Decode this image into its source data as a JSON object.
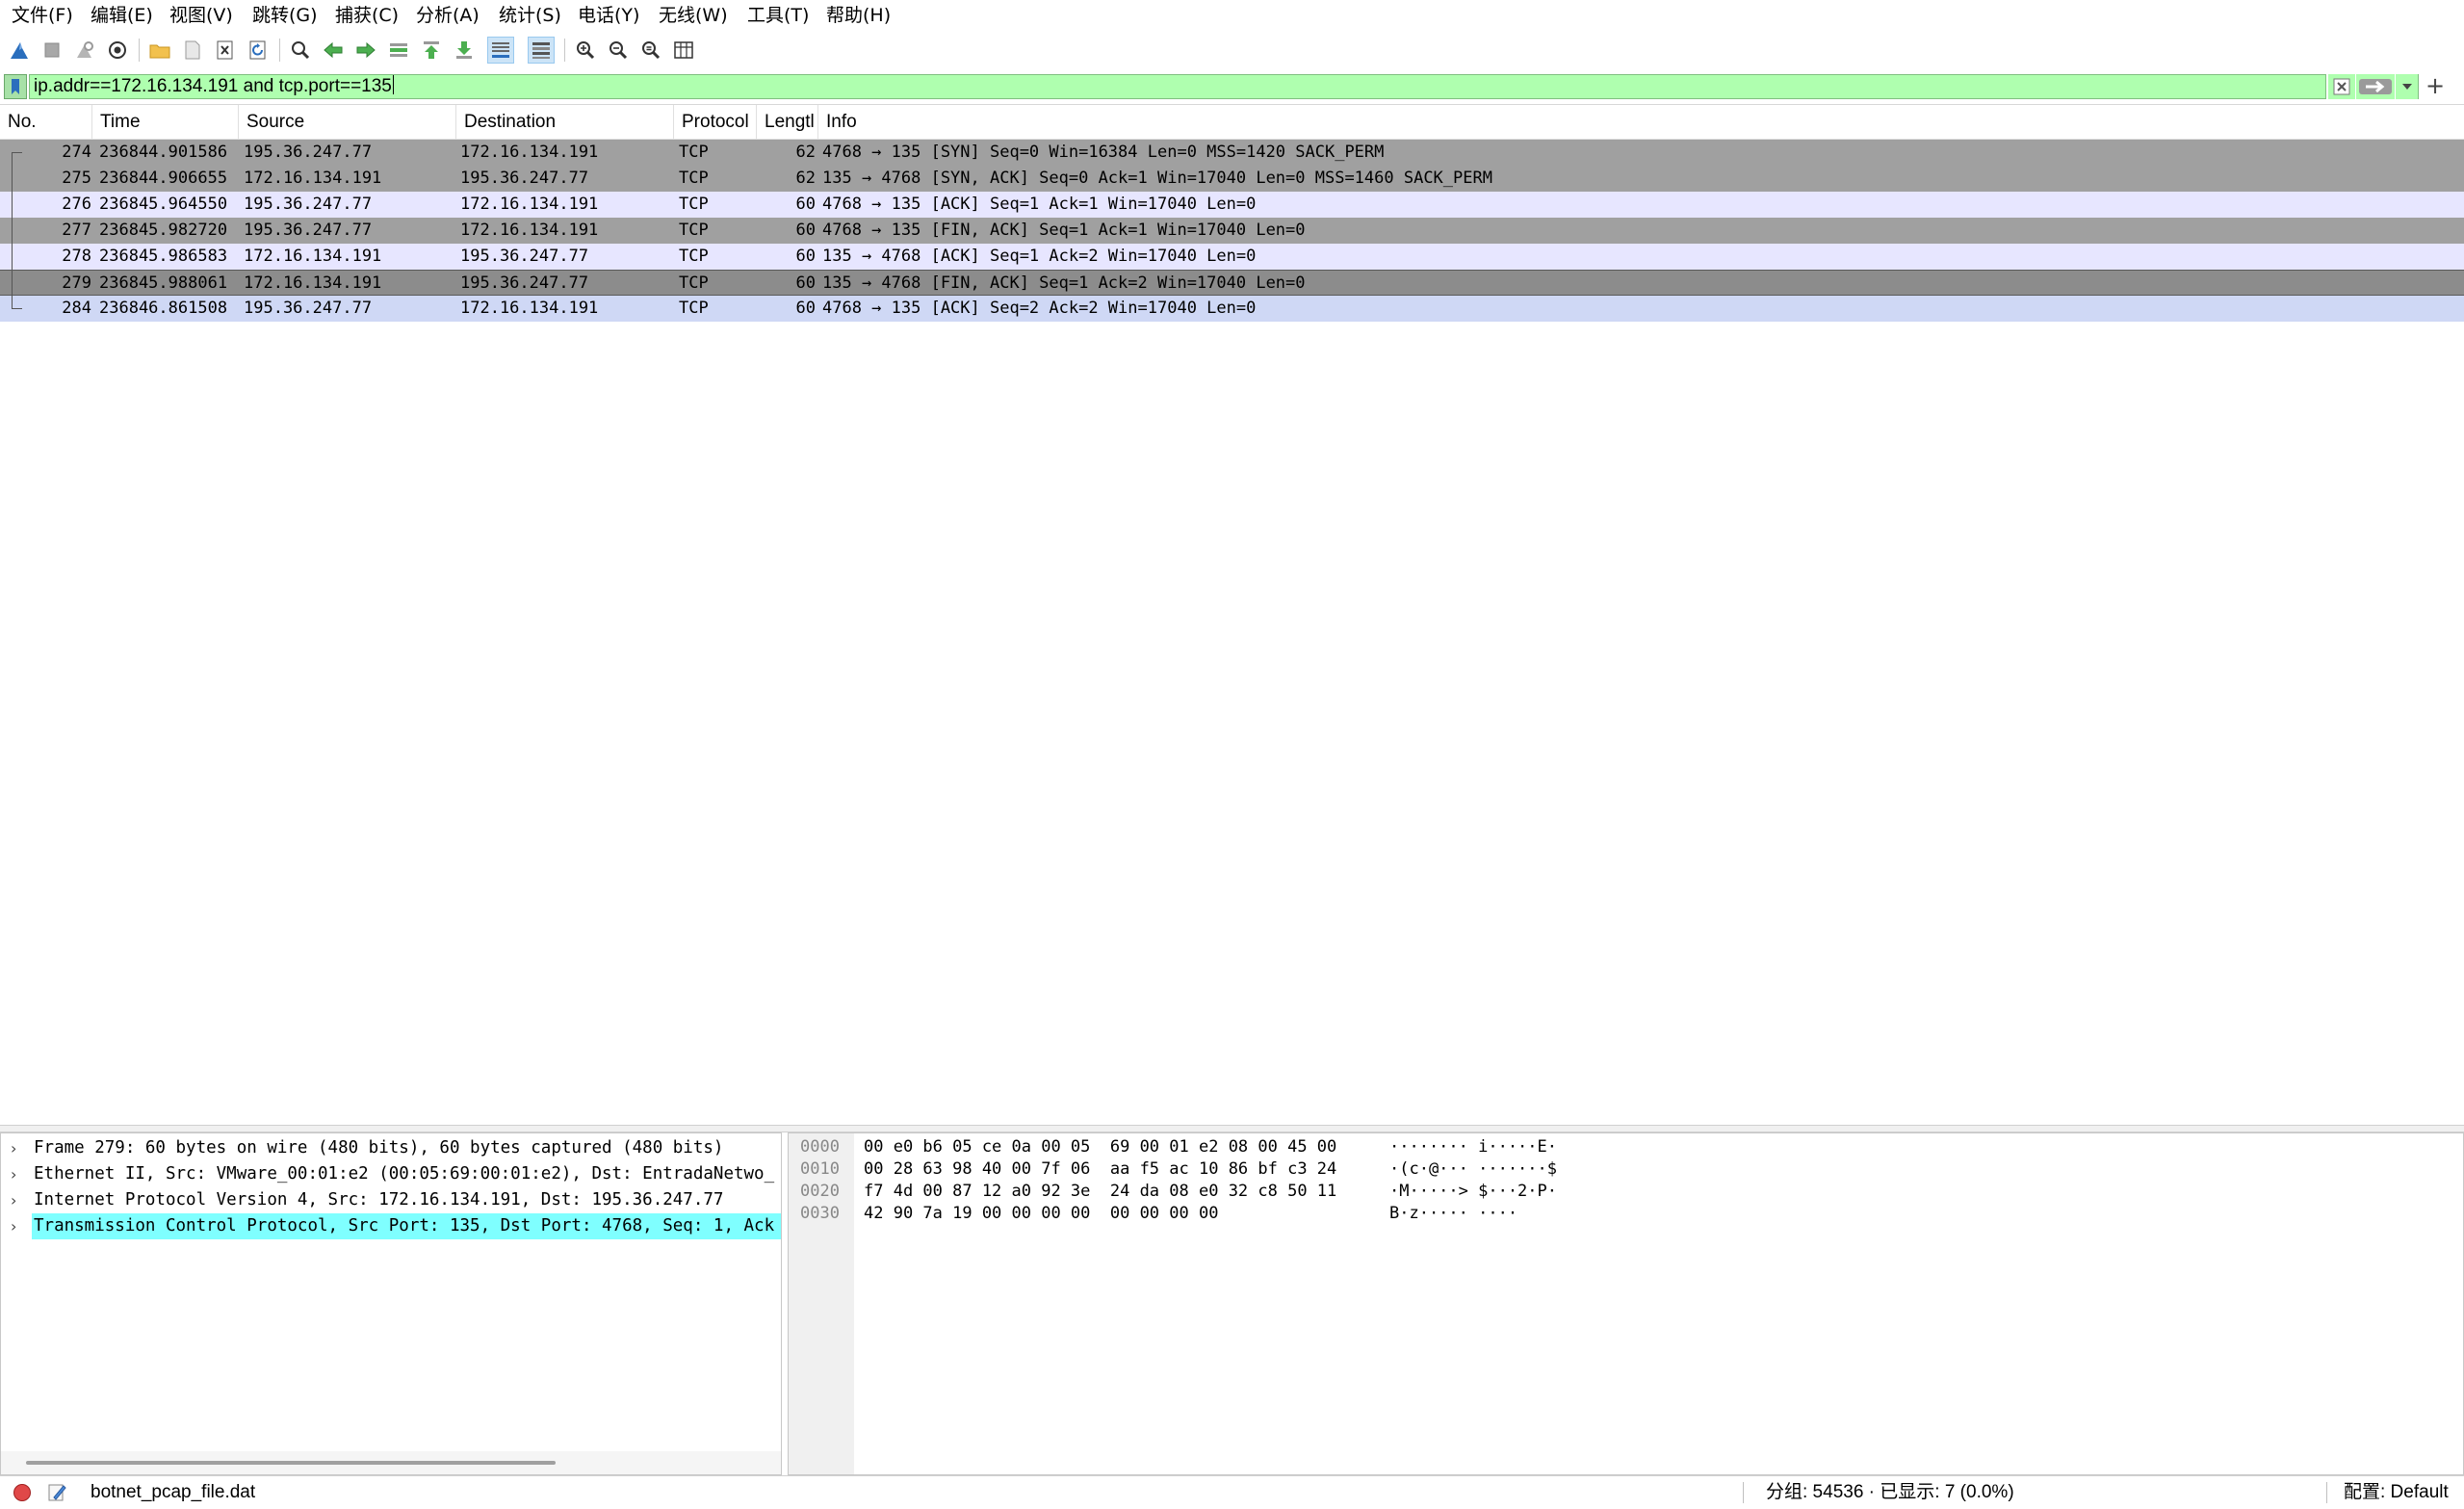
{
  "menu": [
    "文件(F)",
    "编辑(E)",
    "视图(V)",
    "跳转(G)",
    "捕获(C)",
    "分析(A)",
    "统计(S)",
    "电话(Y)",
    "无线(W)",
    "工具(T)",
    "帮助(H)"
  ],
  "toolbar": {
    "icons": [
      "shark-fin-start-icon",
      "stop-square-icon",
      "restart-fin-icon",
      "capture-options-gear-icon",
      "open-folder-icon",
      "save-file-icon",
      "close-file-icon",
      "reload-icon",
      "find-magnifier-icon",
      "go-back-arrow-icon",
      "go-forward-arrow-icon",
      "go-to-packet-icon",
      "go-first-packet-icon",
      "go-last-packet-icon",
      "autoscroll-icon",
      "colorize-lines-icon",
      "zoom-in-icon",
      "zoom-out-icon",
      "zoom-normal-icon",
      "resize-columns-icon"
    ]
  },
  "filter": {
    "value": "ip.addr==172.16.134.191 and tcp.port==135",
    "bg_color": "#afffaf"
  },
  "packet_list": {
    "columns": [
      "No.",
      "Time",
      "Source",
      "Destination",
      "Protocol",
      "Lengtl",
      "Info"
    ],
    "rows": [
      {
        "no": "274",
        "time": "236844.901586",
        "src": "195.36.247.77",
        "dst": "172.16.134.191",
        "proto": "TCP",
        "len": "62",
        "info": "4768 → 135 [SYN] Seq=0 Win=16384 Len=0 MSS=1420 SACK_PERM",
        "style": "dark"
      },
      {
        "no": "275",
        "time": "236844.906655",
        "src": "172.16.134.191",
        "dst": "195.36.247.77",
        "proto": "TCP",
        "len": "62",
        "info": "135 → 4768 [SYN, ACK] Seq=0 Ack=1 Win=17040 Len=0 MSS=1460 SACK_PERM",
        "style": "dark"
      },
      {
        "no": "276",
        "time": "236845.964550",
        "src": "195.36.247.77",
        "dst": "172.16.134.191",
        "proto": "TCP",
        "len": "60",
        "info": "4768 → 135 [ACK] Seq=1 Ack=1 Win=17040 Len=0",
        "style": "light"
      },
      {
        "no": "277",
        "time": "236845.982720",
        "src": "195.36.247.77",
        "dst": "172.16.134.191",
        "proto": "TCP",
        "len": "60",
        "info": "4768 → 135 [FIN, ACK] Seq=1 Ack=1 Win=17040 Len=0",
        "style": "dark"
      },
      {
        "no": "278",
        "time": "236845.986583",
        "src": "172.16.134.191",
        "dst": "195.36.247.77",
        "proto": "TCP",
        "len": "60",
        "info": "135 → 4768 [ACK] Seq=1 Ack=2 Win=17040 Len=0",
        "style": "light"
      },
      {
        "no": "279",
        "time": "236845.988061",
        "src": "172.16.134.191",
        "dst": "195.36.247.77",
        "proto": "TCP",
        "len": "60",
        "info": "135 → 4768 [FIN, ACK] Seq=1 Ack=2 Win=17040 Len=0",
        "style": "sel"
      },
      {
        "no": "284",
        "time": "236846.861508",
        "src": "195.36.247.77",
        "dst": "172.16.134.191",
        "proto": "TCP",
        "len": "60",
        "info": "4768 → 135 [ACK] Seq=2 Ack=2 Win=17040 Len=0",
        "style": "blue"
      }
    ]
  },
  "details": [
    {
      "text": "Frame 279: 60 bytes on wire (480 bits), 60 bytes captured (480 bits)",
      "selected": false
    },
    {
      "text": "Ethernet II, Src: VMware_00:01:e2 (00:05:69:00:01:e2), Dst: EntradaNetwo_",
      "selected": false
    },
    {
      "text": "Internet Protocol Version 4, Src: 172.16.134.191, Dst: 195.36.247.77",
      "selected": false
    },
    {
      "text": "Transmission Control Protocol, Src Port: 135, Dst Port: 4768, Seq: 1, Ack",
      "selected": true
    }
  ],
  "bytes": [
    {
      "offset": "0000",
      "hex": "00 e0 b6 05 ce 0a 00 05  69 00 01 e2 08 00 45 00",
      "ascii": "········ i·····E·"
    },
    {
      "offset": "0010",
      "hex": "00 28 63 98 40 00 7f 06  aa f5 ac 10 86 bf c3 24",
      "ascii": "·(c·@··· ·······$"
    },
    {
      "offset": "0020",
      "hex": "f7 4d 00 87 12 a0 92 3e  24 da 08 e0 32 c8 50 11",
      "ascii": "·M·····> $···2·P·"
    },
    {
      "offset": "0030",
      "hex": "42 90 7a 19 00 00 00 00  00 00 00 00",
      "ascii": "B·z····· ····"
    }
  ],
  "status": {
    "file": "botnet_pcap_file.dat",
    "packets": "分组: 54536 · 已显示: 7 (0.0%)",
    "profile": "配置: Default"
  }
}
